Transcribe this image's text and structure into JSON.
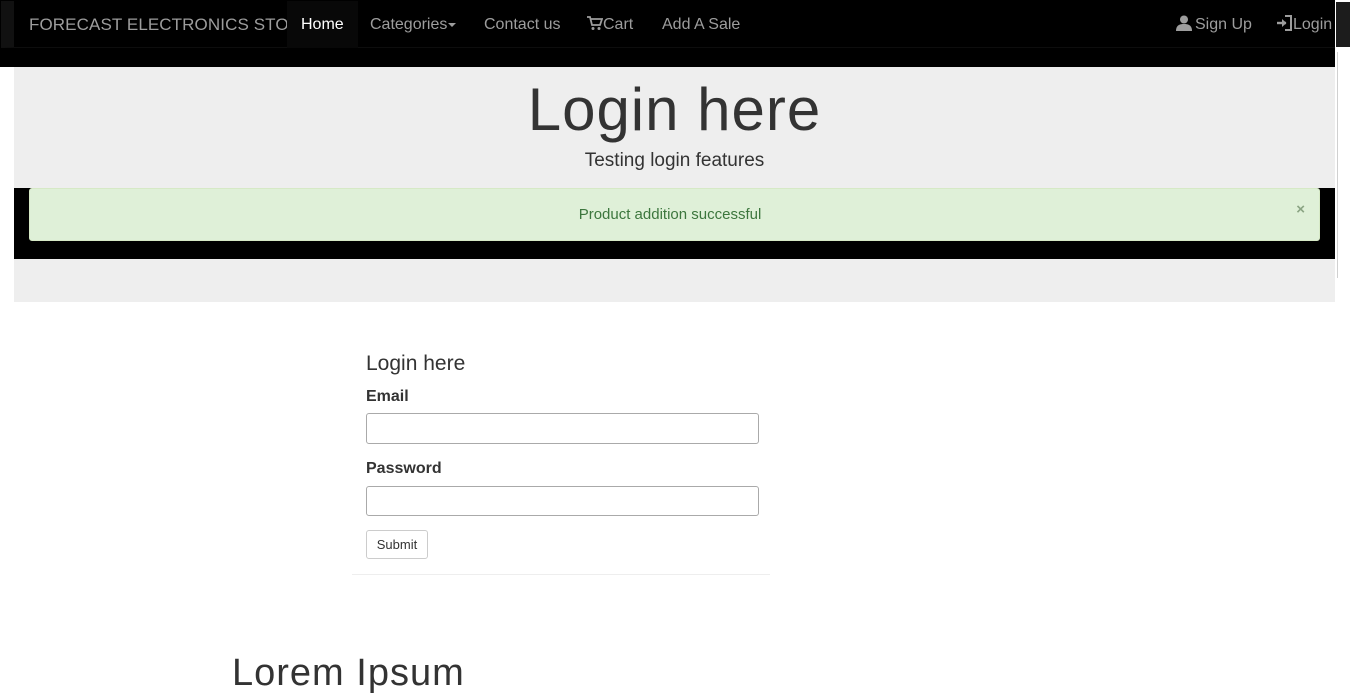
{
  "navbar": {
    "brand": "FORECAST ELECTRONICS STORE",
    "home": "Home",
    "categories": "Categories",
    "contact": "Contact us",
    "cart": "Cart",
    "add_sale": "Add A Sale",
    "signup": "Sign Up",
    "login": "Login"
  },
  "jumbotron": {
    "title": "Login here",
    "subtitle": "Testing login features"
  },
  "alert": {
    "message": "Product addition successful",
    "close": "×"
  },
  "login_form": {
    "heading": "Login here",
    "email_label": "Email",
    "email_value": "",
    "password_label": "Password",
    "password_value": "",
    "submit_label": "Submit"
  },
  "bottom_heading": "Lorem Ipsum",
  "colors": {
    "navbar_bg": "#000000",
    "nav_text": "#9d9d9d",
    "jumbotron_bg": "#eeeeee",
    "alert_bg": "#dff0d8",
    "alert_text": "#3c763d"
  },
  "icons": {
    "cart": "cart-icon",
    "signup": "user-icon",
    "login": "log-in-icon",
    "close": "close-icon"
  }
}
